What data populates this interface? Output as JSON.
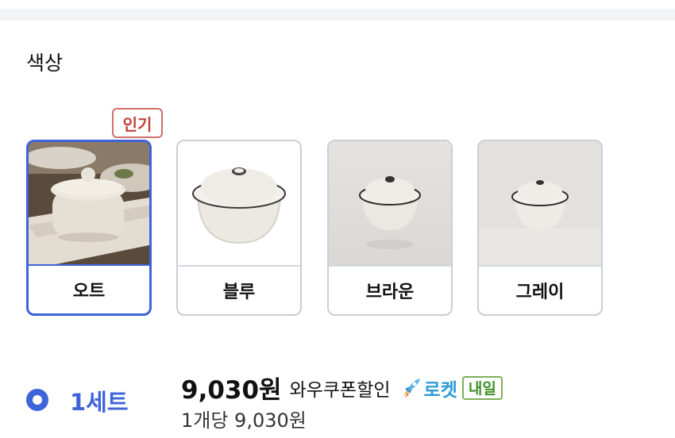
{
  "section": {
    "title": "색상"
  },
  "badge": {
    "label": "인기"
  },
  "options": [
    {
      "label": "오트",
      "selected": true,
      "image": "cup-on-tray-photo"
    },
    {
      "label": "블루",
      "selected": false,
      "image": "lidded-bowl-photo"
    },
    {
      "label": "브라운",
      "selected": false,
      "image": "lidded-bowl-photo"
    },
    {
      "label": "그레이",
      "selected": false,
      "image": "lidded-bowl-photo"
    }
  ],
  "quantity": {
    "label": "1세트",
    "selected": true,
    "price": "9,030원",
    "discount_text": "와우쿠폰할인",
    "rocket_label": "로켓",
    "delivery_tag": "내일",
    "unit_price": "1개당 9,030원"
  },
  "colors": {
    "accent_blue": "#3e64d9",
    "badge_red": "#c2403a",
    "rocket_blue": "#2f9bd7",
    "delivery_green": "#3f8f24"
  }
}
